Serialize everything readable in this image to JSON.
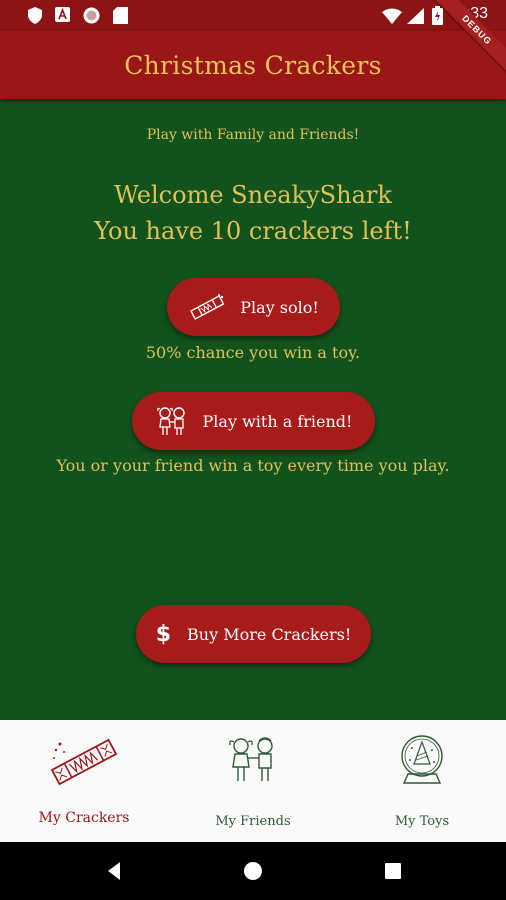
{
  "status_bar": {
    "time": "4:33",
    "icons": [
      "shield-icon",
      "font-icon",
      "record-icon",
      "sd-card-icon",
      "wifi-icon",
      "signal-icon",
      "battery-icon"
    ]
  },
  "debug_banner": "DEBUG",
  "app_bar": {
    "title": "Christmas Crackers"
  },
  "main": {
    "subtitle": "Play with Family and Friends!",
    "welcome_line1": "Welcome SneakyShark",
    "welcome_line2": "You have 10 crackers left!",
    "play_solo": {
      "label": "Play solo!",
      "icon": "cracker-icon",
      "caption": "50% chance you win a toy."
    },
    "play_friend": {
      "label": "Play with a friend!",
      "icon": "kids-icon",
      "caption": "You or your friend win a toy every time you play."
    },
    "buy": {
      "label": "Buy More Crackers!",
      "icon": "dollar-icon"
    }
  },
  "bottom_nav": {
    "items": [
      {
        "label": "My Crackers",
        "icon": "cracker-icon",
        "active": true
      },
      {
        "label": "My Friends",
        "icon": "friends-icon",
        "active": false
      },
      {
        "label": "My Toys",
        "icon": "snow-globe-icon",
        "active": false
      }
    ]
  },
  "colors": {
    "status_bar": "#8c1414",
    "app_bar": "#9b1616",
    "background": "#12531d",
    "gold": "#e0c05a",
    "button": "#a81b1b",
    "nav_active": "#9b1616",
    "nav_inactive": "#2e5a34"
  },
  "system_nav": [
    "back-icon",
    "home-icon",
    "recents-icon"
  ]
}
